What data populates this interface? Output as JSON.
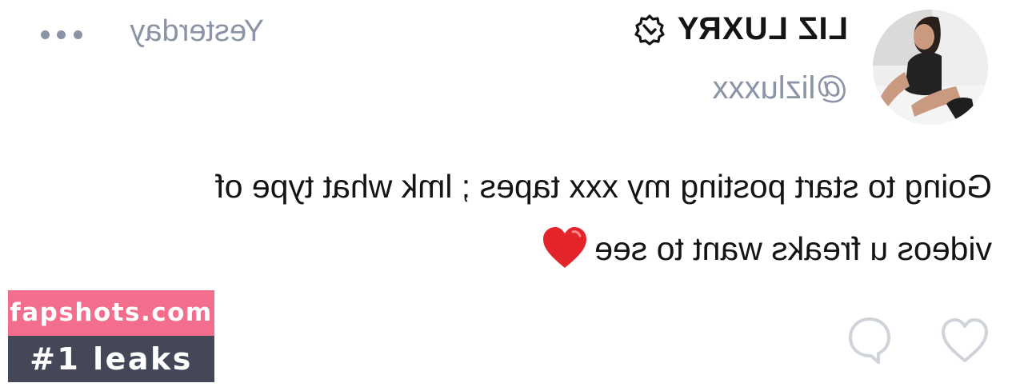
{
  "post": {
    "author": {
      "display_name": "LIZ LUXRY",
      "handle": "@lizluxxx",
      "verified_icon": "verified-badge-icon",
      "avatar": "profile-photo"
    },
    "timestamp": "Yesterday",
    "more_icon": "more-horizontal-icon",
    "text": "Going to start posting my xxx tapes ; lmk what type of\nvideos u freaks want to see",
    "emoji": "heart-emoji",
    "actions": {
      "like_icon": "heart-outline-icon",
      "comment_icon": "comment-bubble-icon"
    }
  },
  "watermark": {
    "site": "fapshots.com",
    "tag": "#1 leaks"
  },
  "colors": {
    "muted_text": "#8a94a6",
    "primary_text": "#141414",
    "icon_stroke": "#cfd3da",
    "heart_red": "#e3242b",
    "watermark_pink": "#f36d8c",
    "watermark_dark": "#434757"
  }
}
